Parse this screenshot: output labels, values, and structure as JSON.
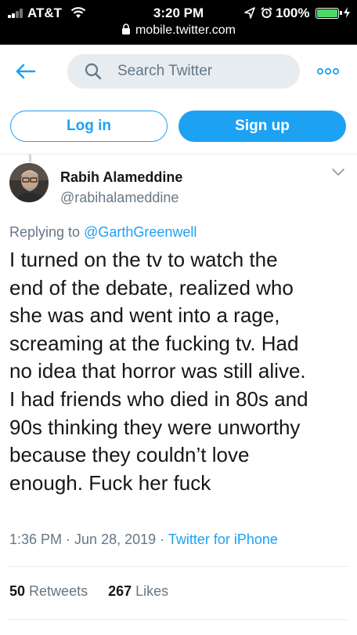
{
  "status_bar": {
    "carrier": "AT&T",
    "time": "3:20 PM",
    "battery": "100%",
    "url": "mobile.twitter.com"
  },
  "header": {
    "search_placeholder": "Search Twitter"
  },
  "auth": {
    "login_label": "Log in",
    "signup_label": "Sign up"
  },
  "tweet": {
    "author_name": "Rabih Alameddine",
    "author_handle": "@rabihalameddine",
    "replying_prefix": "Replying to ",
    "replying_mention": "@GarthGreenwell",
    "lines": [
      "I turned on the tv to watch the",
      "end of the debate, realized who",
      "she was and went into a rage,",
      "screaming at the fucking tv. Had",
      "no idea that horror was still alive.",
      "I had friends who died in 80s and",
      "90s thinking they were unworthy",
      "because they couldn’t love",
      "enough. Fuck her fuck"
    ],
    "time": "1:36 PM",
    "separator1": " · ",
    "date": "Jun 28, 2019",
    "separator2": " · ",
    "source": "Twitter for iPhone",
    "retweets_count": "50",
    "retweets_label": "Retweets",
    "likes_count": "267",
    "likes_label": "Likes"
  },
  "colors": {
    "accent": "#1da1f2",
    "muted": "#657786",
    "text": "#14171a",
    "search_bg": "#e6ecf0",
    "battery": "#4cd964"
  },
  "icons": [
    "signal-icon",
    "wifi-icon",
    "location-icon",
    "alarm-icon",
    "battery-icon",
    "charging-icon",
    "lock-icon",
    "back-arrow-icon",
    "search-icon",
    "more-icon",
    "chevron-down-icon"
  ]
}
